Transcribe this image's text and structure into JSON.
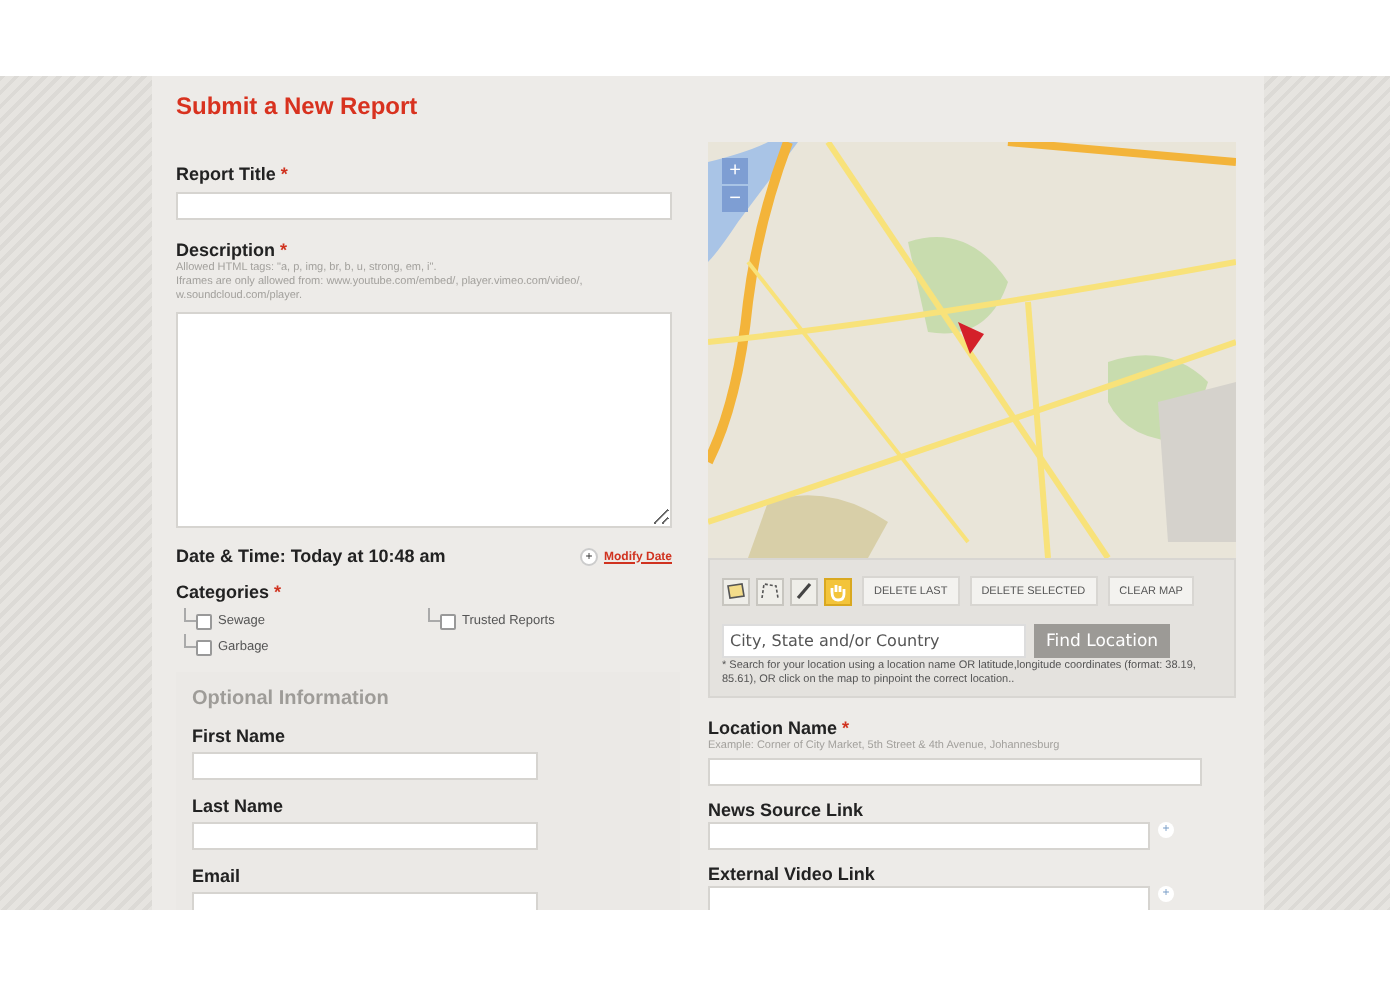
{
  "title": "Submit a New Report",
  "report_title": {
    "label": "Report Title",
    "mark": "*"
  },
  "description": {
    "label": "Description",
    "mark": "*",
    "hint_lines": [
      "Allowed HTML tags: \"a, p, img, br, b, u, strong, em, i\".",
      "Iframes are only allowed from: www.youtube.com/embed/, player.vimeo.com/video/, w.soundcloud.com/player."
    ]
  },
  "date_time": {
    "label": "Date & Time: Today at 10:48 am",
    "link_icon": "+",
    "link": "Modify Date"
  },
  "categories": {
    "label": "Categories",
    "mark": "*",
    "columns": [
      [
        {
          "label": "Sewage",
          "checked": false
        },
        {
          "label": "Garbage",
          "checked": false
        }
      ],
      [
        {
          "label": "Trusted Reports",
          "checked": false
        }
      ]
    ]
  },
  "optional": {
    "heading": "Optional Information",
    "fields": [
      {
        "label": "First Name"
      },
      {
        "label": "Last Name"
      },
      {
        "label": "Email"
      }
    ]
  },
  "map": {
    "zoom_in": "+",
    "zoom_out": "−",
    "tools": [
      {
        "kind": "polygon",
        "selected": false
      },
      {
        "kind": "line",
        "selected": false
      },
      {
        "kind": "pencil",
        "selected": false
      },
      {
        "kind": "hand",
        "selected": true
      }
    ],
    "buttons": [
      "DELETE LAST",
      "DELETE SELECTED",
      "CLEAR MAP"
    ],
    "search_placeholder": "City, State and/or Country",
    "find_button": "Find Location",
    "note": "* Search for your location using a location name OR latitude,longitude coordinates (format: 38.19, 85.61), OR click on the map to pinpoint the correct location.."
  },
  "location": {
    "label": "Location Name",
    "mark": "*",
    "hint": "Example: Corner of City Market, 5th Street & 4th Avenue, Johannesburg"
  },
  "links": [
    {
      "label": "News Source Link",
      "add": "+"
    },
    {
      "label": "External Video Link",
      "add": "+"
    }
  ]
}
